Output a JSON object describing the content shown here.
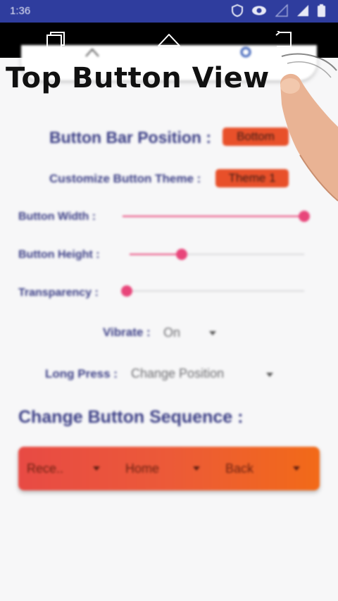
{
  "status_bar": {
    "time": "1:36"
  },
  "overlay": {
    "headline": "Top Button View"
  },
  "settings": {
    "position": {
      "label": "Button Bar Position :",
      "value": "Bottom"
    },
    "theme": {
      "label": "Customize Button Theme :",
      "value": "Theme 1"
    },
    "sliders": [
      {
        "label": "Button Width :",
        "value_fraction": 1.0
      },
      {
        "label": "Button Height :",
        "value_fraction": 0.3
      },
      {
        "label": "Transparency :",
        "value_fraction": 0.0
      }
    ],
    "vibrate": {
      "label": "Vibrate :",
      "value": "On"
    },
    "long_press": {
      "label": "Long Press :",
      "value": "Change Position"
    }
  },
  "sequence": {
    "title": "Change Button Sequence :",
    "items": [
      "Rece..",
      "Home",
      "Back"
    ]
  },
  "colors": {
    "status_bar": "#2f3d9e",
    "accent": "#e8457a",
    "pill": "#e8502a",
    "label": "#3a3d85"
  }
}
